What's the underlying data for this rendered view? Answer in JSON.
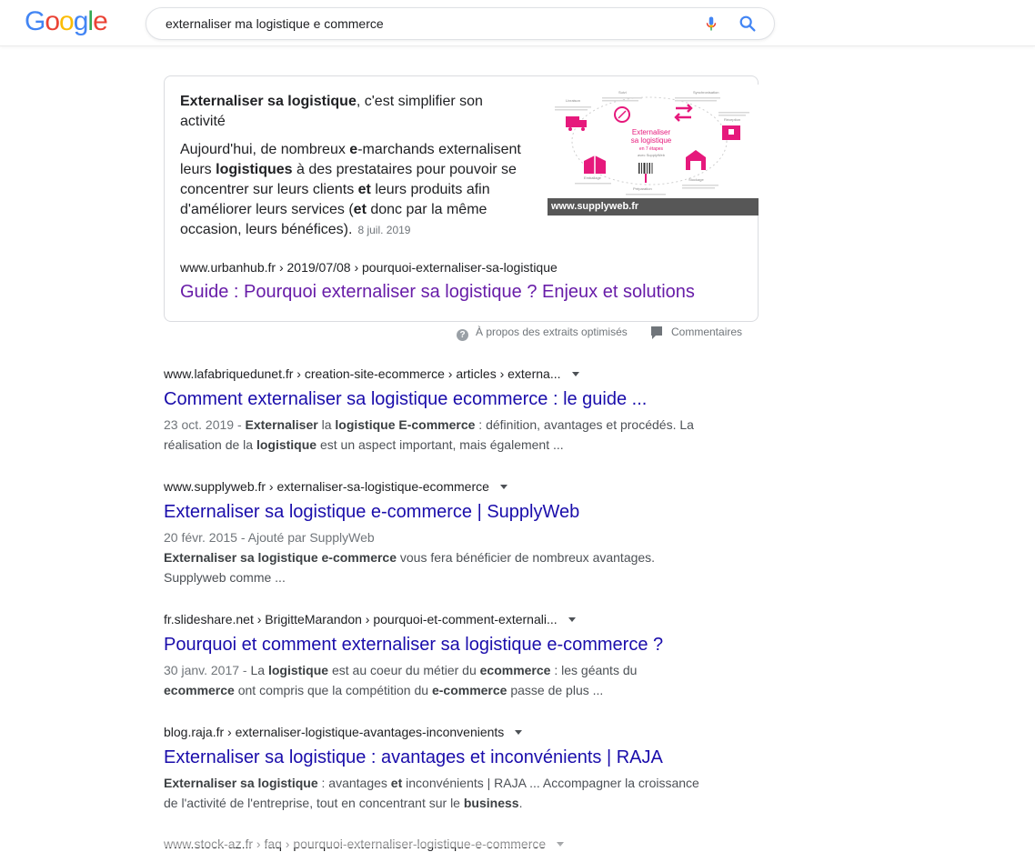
{
  "header": {
    "logo": [
      "G",
      "o",
      "o",
      "g",
      "l",
      "e"
    ],
    "query": "externaliser ma logistique e commerce"
  },
  "cutline": "…, …p…g…p…",
  "snippet": {
    "heading_bold": "Externaliser sa logistique",
    "heading_rest": ", c'est simplifier son activité",
    "body_parts": [
      {
        "t": "Aujourd'hui, de nombreux ",
        "b": false
      },
      {
        "t": "e",
        "b": true
      },
      {
        "t": "-marchands externalisent leurs ",
        "b": false
      },
      {
        "t": "logistiques",
        "b": true
      },
      {
        "t": " à des prestataires pour pouvoir se concentrer sur leurs clients ",
        "b": false
      },
      {
        "t": "et",
        "b": true
      },
      {
        "t": " leurs produits afin d'améliorer leurs services (",
        "b": false
      },
      {
        "t": "et",
        "b": true
      },
      {
        "t": " donc par la même occasion, leurs bénéfices).",
        "b": false
      }
    ],
    "date": "8 juil. 2019",
    "url": "www.urbanhub.fr › 2019/07/08 › pourquoi-externaliser-sa-logistique",
    "title": "Guide : Pourquoi externaliser sa logistique ? Enjeux et solutions",
    "image_caption": "www.supplyweb.fr",
    "image_text": {
      "center": [
        "Externaliser",
        "sa logistique",
        "en 7 étapes",
        "avec SupplyWeb"
      ],
      "steps": [
        "Livraison",
        "Suivi",
        "Synchronisation",
        "Réception",
        "Stockage",
        "Préparation",
        "Emballage"
      ]
    },
    "about": "À propos des extraits optimisés",
    "feedback": "Commentaires"
  },
  "results": [
    {
      "url": "www.lafabriquedunet.fr › creation-site-ecommerce › articles › externa...",
      "title": "Comment externaliser sa logistique ecommerce : le guide ...",
      "date": "23 oct. 2019 - ",
      "desc": [
        {
          "t": "Externaliser",
          "b": true
        },
        {
          "t": " la ",
          "b": false
        },
        {
          "t": "logistique E-commerce",
          "b": true
        },
        {
          "t": " : définition, avantages et procédés. La réalisation de la ",
          "b": false
        },
        {
          "t": "logistique",
          "b": true
        },
        {
          "t": " est un aspect important, mais également ...",
          "b": false
        }
      ]
    },
    {
      "url": "www.supplyweb.fr › externaliser-sa-logistique-ecommerce",
      "title": "Externaliser sa logistique e-commerce | SupplyWeb",
      "date": "20 févr. 2015 - Ajouté par SupplyWeb",
      "date_block": true,
      "desc": [
        {
          "t": "Externaliser sa logistique e-commerce",
          "b": true
        },
        {
          "t": " vous fera bénéficier de nombreux avantages. Supplyweb comme ...",
          "b": false
        }
      ]
    },
    {
      "url": "fr.slideshare.net › BrigitteMarandon › pourquoi-et-comment-externali...",
      "title": "Pourquoi et comment externaliser sa logistique e-commerce ?",
      "date": "30 janv. 2017 - ",
      "desc": [
        {
          "t": "La ",
          "b": false
        },
        {
          "t": "logistique",
          "b": true
        },
        {
          "t": " est au coeur du métier du ",
          "b": false
        },
        {
          "t": "ecommerce",
          "b": true
        },
        {
          "t": " : les géants du ",
          "b": false
        },
        {
          "t": "ecommerce",
          "b": true
        },
        {
          "t": " ont compris que la compétition du ",
          "b": false
        },
        {
          "t": "e-commerce",
          "b": true
        },
        {
          "t": " passe de plus ...",
          "b": false
        }
      ]
    },
    {
      "url": "blog.raja.fr › externaliser-logistique-avantages-inconvenients",
      "title": "Externaliser sa logistique : avantages et inconvénients | RAJA",
      "date": "",
      "desc": [
        {
          "t": "Externaliser sa logistique",
          "b": true
        },
        {
          "t": " : avantages ",
          "b": false
        },
        {
          "t": "et",
          "b": true
        },
        {
          "t": " inconvénients | RAJA ... Accompagner la croissance de l'activité de l'entreprise, tout en concentrant sur le ",
          "b": false
        },
        {
          "t": "business",
          "b": true
        },
        {
          "t": ".",
          "b": false
        }
      ]
    },
    {
      "url": "www.stock-az.fr › faq › pourquoi-externaliser-logistique-e-commerce",
      "title": "",
      "date": "",
      "desc": []
    }
  ],
  "colors": {
    "link": "#1a0dab",
    "visited": "#681da8",
    "accent": "#e6197c"
  }
}
